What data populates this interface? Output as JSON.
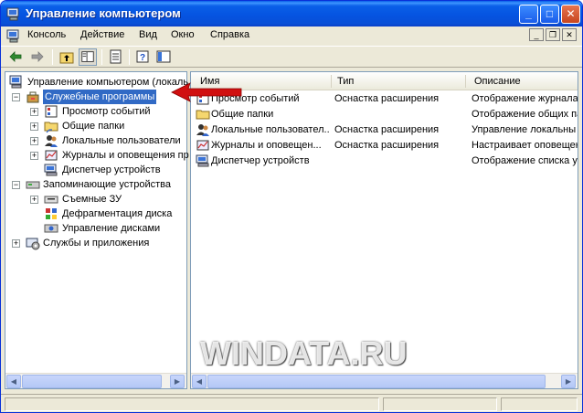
{
  "window": {
    "title": "Управление компьютером",
    "buttons": {
      "minimize": "_",
      "maximize": "□",
      "close": "✕"
    }
  },
  "menu": {
    "items": [
      {
        "label": "Консоль"
      },
      {
        "label": "Действие"
      },
      {
        "label": "Вид"
      },
      {
        "label": "Окно"
      },
      {
        "label": "Справка"
      }
    ],
    "mdi_buttons": {
      "minimize": "_",
      "restore": "❐",
      "close": "✕"
    }
  },
  "tree": {
    "root": "Управление компьютером (локаль",
    "items": [
      {
        "label": "Служебные программы",
        "selected": true,
        "expander": "−"
      },
      {
        "label": "Просмотр событий",
        "expander": "+"
      },
      {
        "label": "Общие папки",
        "expander": "+"
      },
      {
        "label": "Локальные пользователи",
        "expander": "+"
      },
      {
        "label": "Журналы и оповещения пр",
        "expander": "+"
      },
      {
        "label": "Диспетчер устройств"
      },
      {
        "label": "Запоминающие устройства",
        "expander": "−"
      },
      {
        "label": "Съемные ЗУ",
        "expander": "+"
      },
      {
        "label": "Дефрагментация диска"
      },
      {
        "label": "Управление дисками"
      },
      {
        "label": "Службы и приложения",
        "expander": "+"
      }
    ]
  },
  "list": {
    "columns": [
      "Имя",
      "Тип",
      "Описание"
    ],
    "rows": [
      {
        "name": "Просмотр событий",
        "type": "Оснастка расширения",
        "desc": "Отображение журнала"
      },
      {
        "name": "Общие папки",
        "type": "",
        "desc": "Отображение общих па"
      },
      {
        "name": "Локальные пользовател...",
        "type": "Оснастка расширения",
        "desc": "Управление локальны"
      },
      {
        "name": "Журналы и оповещен...",
        "type": "Оснастка расширения",
        "desc": "Настраивает оповещен"
      },
      {
        "name": "Диспетчер устройств",
        "type": "",
        "desc": "Отображение списка у"
      }
    ]
  },
  "watermark": "WINDATA.RU",
  "colors": {
    "selection": "#316ac5",
    "arrow": "#d01010",
    "titlebar": "#0a5fe8"
  }
}
